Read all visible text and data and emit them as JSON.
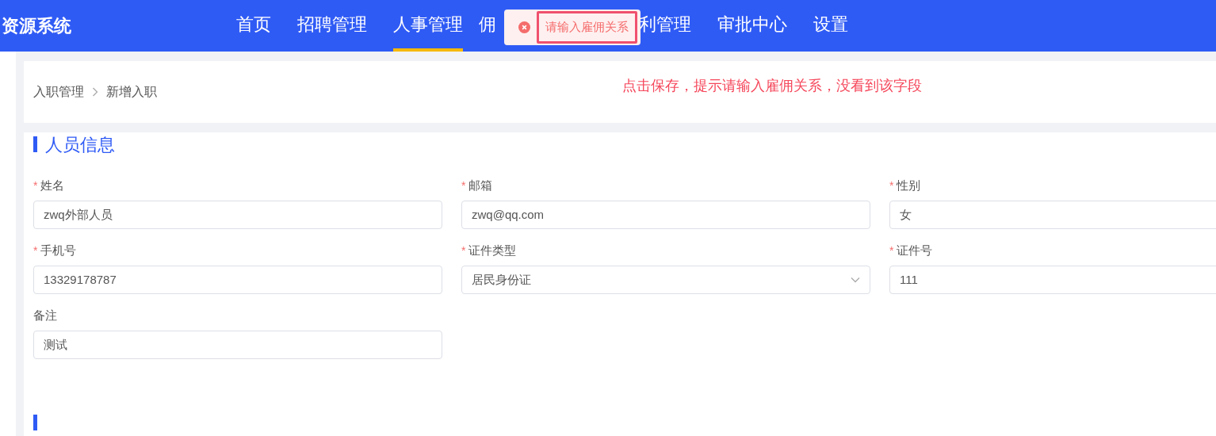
{
  "header": {
    "logo": "资源系统",
    "nav": [
      {
        "label": "首页",
        "selected": false
      },
      {
        "label": "招聘管理",
        "selected": false
      },
      {
        "label": "人事管理",
        "selected": true
      },
      {
        "label": "佣",
        "selected": false
      },
      {
        "label": "利管理",
        "selected": false
      },
      {
        "label": "审批中心",
        "selected": false
      },
      {
        "label": "设置",
        "selected": false
      }
    ]
  },
  "toast": {
    "message": "请输入雇佣关系"
  },
  "annotation": {
    "text": "点击保存，提示请输入雇佣关系，没看到该字段"
  },
  "breadcrumb": [
    "入职管理",
    "新增入职"
  ],
  "section": {
    "title": "人员信息",
    "fields": [
      {
        "label": "姓名",
        "required_mark": "*",
        "kind": "text",
        "value": "zwq外部人员"
      },
      {
        "label": "邮箱",
        "required_mark": "*",
        "kind": "text",
        "value": "zwq@qq.com"
      },
      {
        "label": "性别",
        "required_mark": "*",
        "kind": "text",
        "value": "女"
      },
      {
        "label": "手机号",
        "required_mark": "*",
        "kind": "text",
        "value": "13329178787"
      },
      {
        "label": "证件类型",
        "required_mark": "*",
        "kind": "select",
        "value": "居民身份证"
      },
      {
        "label": "证件号",
        "required_mark": "*",
        "kind": "text",
        "value": "111"
      },
      {
        "label": "备注",
        "kind": "text",
        "value": "测试"
      }
    ]
  }
}
